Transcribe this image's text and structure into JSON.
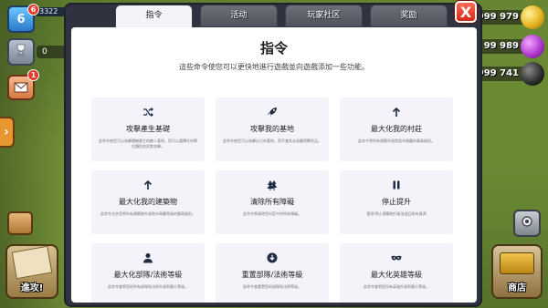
{
  "hud": {
    "level": "6",
    "level_badge_count": "6",
    "xp_text": "3322",
    "trophies": "0",
    "mail_badge": "1",
    "attack_label": "進攻!",
    "shop_label": "商店"
  },
  "resources": {
    "gold": "999 979",
    "elixir": "99 989",
    "dark_elixir": "999 741"
  },
  "modal": {
    "tabs": [
      "指令",
      "活动",
      "玩家社区",
      "奖励"
    ],
    "active_tab": 0,
    "close_label": "X",
    "title": "指令",
    "subtitle": "這些命令使您可以更快地進行遊戲並向遊戲添加一些功能。",
    "cards": [
      {
        "icon": "shuffle-icon",
        "title": "攻擊產生基礎",
        "desc": "此命令使您可以攻擊隨機產生的敵人基地。您可以選擇任何單位類別並對其攻擊。"
      },
      {
        "icon": "rocket-icon",
        "title": "攻擊我的基地",
        "desc": "此命令使您可以攻擊自己的基地。您不會失去或贏得戰利品。"
      },
      {
        "icon": "arrow-up-icon",
        "title": "最大化我的村莊",
        "desc": "此命令將所有建築升級到該市政廳的最高級別。"
      },
      {
        "icon": "arrow-up-icon",
        "title": "最大化我的建築物",
        "desc": "此命令允許您將所有建築物升級到市政廳等級的最高級別。"
      },
      {
        "icon": "tree-icon",
        "title": "清除所有障礙",
        "desc": "此命令將清除您村莊中的所有障礙。"
      },
      {
        "icon": "pause-icon",
        "title": "停止提升",
        "desc": "暫停/停止建築物升級並返回所有資源"
      },
      {
        "icon": "user-icon",
        "title": "最大化部隊/法術等級",
        "desc": "此命令會將您的所有部隊和法術升級到最大等級。"
      },
      {
        "icon": "arrow-down-circle-icon",
        "title": "重置部隊/法術等級",
        "desc": "該命令會重置您的部隊和法術等級。"
      },
      {
        "icon": "mask-icon",
        "title": "最大化英雄等級",
        "desc": "此命令會將您所有英雄升級到最大等級。"
      }
    ]
  },
  "colors": {
    "icon_navy": "#1f2a44",
    "close_red": "#e2321f",
    "card_bg": "#f3f3f9",
    "grass": "#6c8a34"
  }
}
